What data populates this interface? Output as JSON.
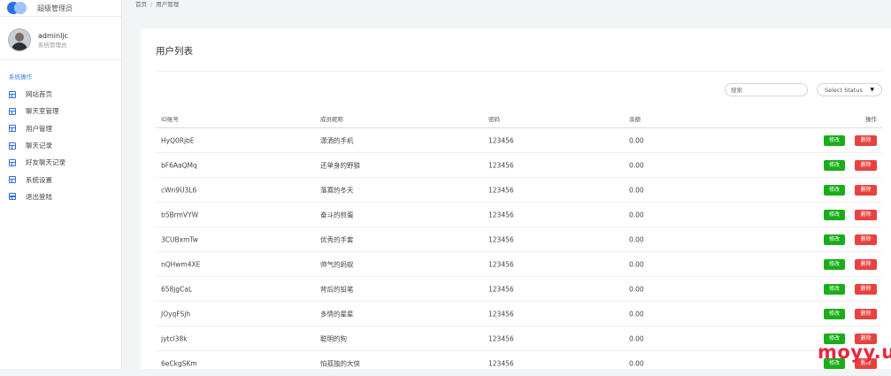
{
  "brand": {
    "title": "超级管理员"
  },
  "profile": {
    "name": "adminljc",
    "role": "系统管理员"
  },
  "sidebar": {
    "section_label": "系统操作",
    "items": [
      {
        "label": "网站首页",
        "icon": "layout-icon"
      },
      {
        "label": "聊天室管理",
        "icon": "layout-icon"
      },
      {
        "label": "用户管理",
        "icon": "layout-icon"
      },
      {
        "label": "聊天记录",
        "icon": "layout-icon"
      },
      {
        "label": "好友聊天记录",
        "icon": "layout-icon"
      },
      {
        "label": "系统设置",
        "icon": "layout-icon"
      },
      {
        "label": "退出登陆",
        "icon": "layout-icon"
      }
    ]
  },
  "breadcrumb": {
    "home": "首页",
    "sep": "/",
    "current": "用户管理"
  },
  "card": {
    "title": "用户列表"
  },
  "filters": {
    "search_placeholder": "搜索",
    "status_value": "Select Status"
  },
  "table": {
    "headers": {
      "id": "ID账号",
      "name": "成员昵称",
      "password": "密码",
      "balance": "余额",
      "actions": "操作"
    },
    "edit_label": "修改",
    "delete_label": "删除",
    "rows": [
      {
        "id": "HyQ0RjbE",
        "name": "潇洒的手机",
        "password": "123456",
        "balance": "0.00"
      },
      {
        "id": "bF6AaQMq",
        "name": "还单身的野狼",
        "password": "123456",
        "balance": "0.00"
      },
      {
        "id": "cWn9U3L6",
        "name": "落寞的冬天",
        "password": "123456",
        "balance": "0.00"
      },
      {
        "id": "b5BrmVYW",
        "name": "奋斗的煎蛋",
        "password": "123456",
        "balance": "0.00"
      },
      {
        "id": "3CUBxmTw",
        "name": "优秀的手套",
        "password": "123456",
        "balance": "0.00"
      },
      {
        "id": "nQHwm4XE",
        "name": "帅气的蚂蚁",
        "password": "123456",
        "balance": "0.00"
      },
      {
        "id": "658jgCaL",
        "name": "背后的铅笔",
        "password": "123456",
        "balance": "0.00"
      },
      {
        "id": "JOyqFSjh",
        "name": "多情的星星",
        "password": "123456",
        "balance": "0.00"
      },
      {
        "id": "jytcl38k",
        "name": "聪明的狗",
        "password": "123456",
        "balance": "0.00"
      },
      {
        "id": "6eCkgSKm",
        "name": "怕孤独的大侠",
        "password": "123456",
        "balance": "0.00"
      }
    ]
  },
  "watermark": "moyy.us",
  "colors": {
    "accent": "#2f6fe5",
    "edit": "#1aad19",
    "delete": "#e64340",
    "watermark": "#e8263e"
  }
}
